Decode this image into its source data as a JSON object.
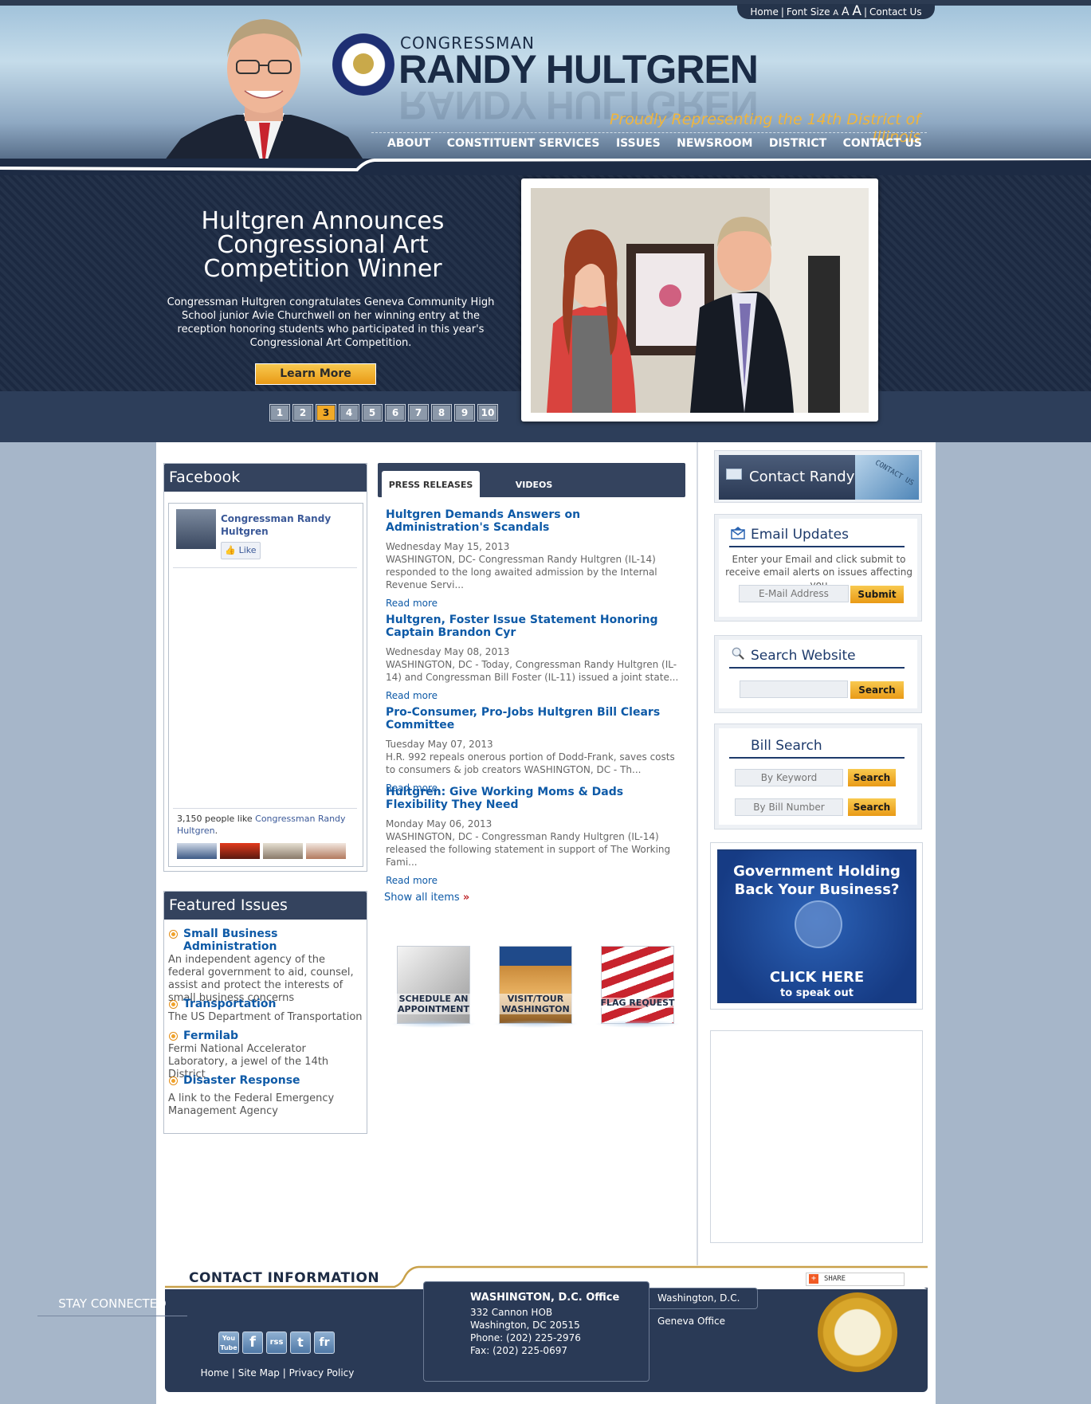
{
  "util": {
    "home": "Home",
    "font_size": "Font Size",
    "a_small": "A",
    "a_med": "A",
    "a_large": "A",
    "contact": "Contact Us"
  },
  "brand": {
    "congressman": "CONGRESSMAN",
    "name": "RANDY HULTGREN",
    "tagline": "Proudly Representing the 14th District of Illinois"
  },
  "nav": [
    "ABOUT",
    "CONSTITUENT SERVICES",
    "ISSUES",
    "NEWSROOM",
    "DISTRICT",
    "CONTACT US"
  ],
  "hero": {
    "title": "Hultgren Announces Congressional Art Competition Winner",
    "text": "Congressman Hultgren congratulates Geneva Community High School junior Avie Churchwell on her winning entry at the reception honoring students who participated in this year's Congressional Art Competition.",
    "button": "Learn More",
    "pages": [
      "1",
      "2",
      "3",
      "4",
      "5",
      "6",
      "7",
      "8",
      "9",
      "10"
    ],
    "active_page": "3"
  },
  "facebook": {
    "title": "Facebook",
    "page_name": "Congressman Randy Hultgren",
    "like": "Like",
    "count_text": "3,150 people like",
    "count_link": "Congressman Randy Hultgren",
    "count_end": "."
  },
  "featured": {
    "title": "Featured Issues",
    "items": [
      {
        "title": "Small Business Administration",
        "desc": "An independent agency of the federal government to aid, counsel, assist and protect the interests of small business concerns"
      },
      {
        "title": "Transportation",
        "desc": "The US Department of Transportation"
      },
      {
        "title": "Fermilab",
        "desc": "Fermi National Accelerator Laboratory, a jewel of the 14th District"
      },
      {
        "title": "Disaster Response",
        "desc": "A link to the Federal Emergency Management Agency"
      }
    ]
  },
  "news": {
    "tabs": [
      "PRESS RELEASES",
      "VIDEOS"
    ],
    "items": [
      {
        "title": "Hultgren Demands Answers on Administration's Scandals",
        "date": "Wednesday May 15, 2013",
        "body": "WASHINGTON, DC- Congressman Randy Hultgren (IL-14) responded to the long awaited admission by the Internal Revenue Servi...",
        "more": "Read more"
      },
      {
        "title": "Hultgren, Foster Issue Statement Honoring Captain Brandon Cyr",
        "date": "Wednesday May 08, 2013",
        "body": "WASHINGTON, DC - Today, Congressman Randy Hultgren (IL-14) and Congressman Bill Foster (IL-11) issued a joint state...",
        "more": "Read more"
      },
      {
        "title": "Pro-Consumer, Pro-Jobs Hultgren Bill Clears Committee",
        "date": "Tuesday May 07, 2013",
        "body": "H.R. 992 repeals onerous portion of Dodd-Frank, saves costs to consumers & job creators WASHINGTON, DC - Th...",
        "more": "Read more"
      },
      {
        "title": "Hultgren: Give Working Moms & Dads Flexibility They Need",
        "date": "Monday May 06, 2013",
        "body": "WASHINGTON, DC - Congressman Randy Hultgren (IL-14) released the following statement in support of The Working Fami...",
        "more": "Read more"
      }
    ],
    "show_all": "Show all items",
    "show_all_arrow": "»"
  },
  "quicklinks": [
    {
      "label": "SCHEDULE AN APPOINTMENT"
    },
    {
      "label": "VISIT/TOUR WASHINGTON"
    },
    {
      "label": "FLAG REQUEST"
    }
  ],
  "sidebar": {
    "contact_randy": "Contact Randy",
    "contact_key": "CONTACT US",
    "email": {
      "title": "Email Updates",
      "desc": "Enter your Email and click submit to receive email alerts on issues affecting you",
      "placeholder": "E-Mail Address",
      "button": "Submit"
    },
    "search": {
      "title": "Search Website",
      "button": "Search"
    },
    "bill": {
      "title": "Bill Search",
      "kw_placeholder": "By Keyword",
      "num_placeholder": "By Bill Number",
      "button1": "Search",
      "button2": "Search"
    },
    "ad": {
      "headline": "Government Holding Back Your Business?",
      "cta": "CLICK HERE",
      "sub": "to speak out"
    }
  },
  "footer": {
    "title": "CONTACT INFORMATION",
    "stay": "STAY CONNECTED",
    "social": [
      "You Tube",
      "f",
      "rss",
      "t",
      "fr"
    ],
    "links": [
      "Home",
      "Site Map",
      "Privacy Policy"
    ],
    "office": {
      "title": "WASHINGTON, D.C. Office",
      "lines": [
        "332 Cannon HOB",
        "Washington, DC 20515",
        "Phone: (202) 225-2976",
        "Fax: (202) 225-0697"
      ]
    },
    "tabs": [
      "Washington, D.C.",
      "Geneva Office"
    ],
    "share": "SHARE"
  },
  "colors": {
    "navy": "#34435e",
    "link": "#0e5aa7",
    "accent": "#f0a22a",
    "gold_tagline": "#f0b53c"
  }
}
